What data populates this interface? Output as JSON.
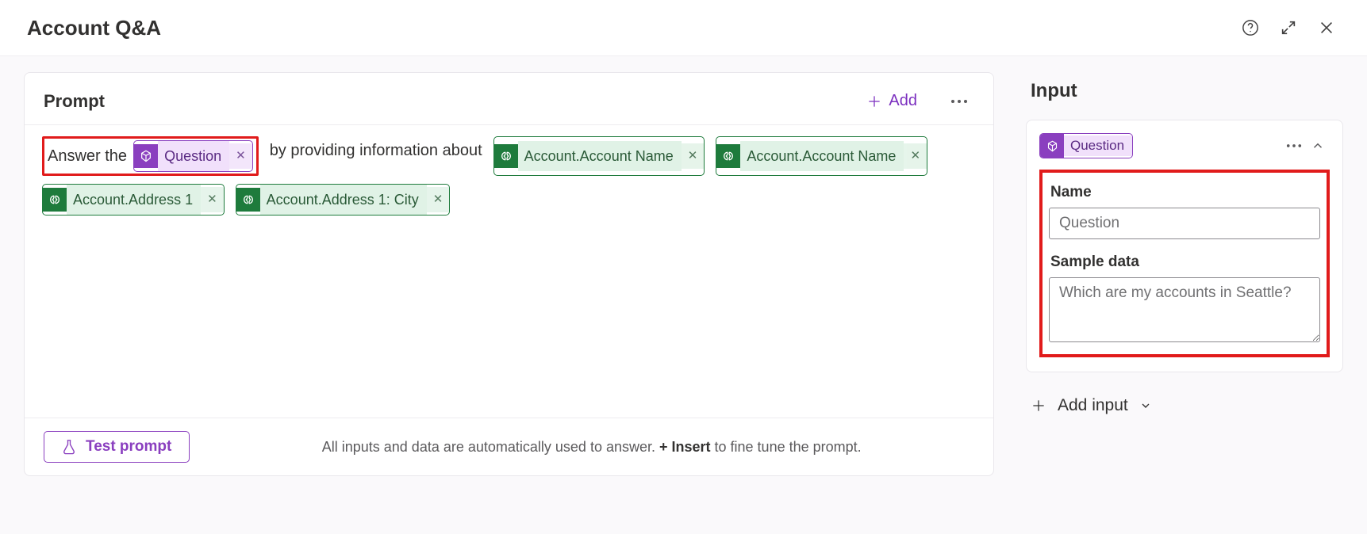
{
  "header": {
    "title": "Account Q&A"
  },
  "prompt": {
    "section_title": "Prompt",
    "add_label": "Add",
    "text_before_question": "Answer the",
    "question_chip": "Question",
    "text_after_question": "by providing information about",
    "data_chips": [
      "Account.Account Name",
      "Account.Account Name",
      "Account.Address 1",
      "Account.Address 1: City"
    ],
    "test_label": "Test prompt",
    "hint_prefix": "All inputs and data are automatically used to answer. ",
    "hint_bold": "+ Insert",
    "hint_suffix": " to fine tune the prompt."
  },
  "right": {
    "panel_title": "Input",
    "chip_label": "Question",
    "name_label": "Name",
    "name_value": "Question",
    "sample_label": "Sample data",
    "sample_value": "Which are my accounts in Seattle?",
    "add_input_label": "Add input"
  }
}
